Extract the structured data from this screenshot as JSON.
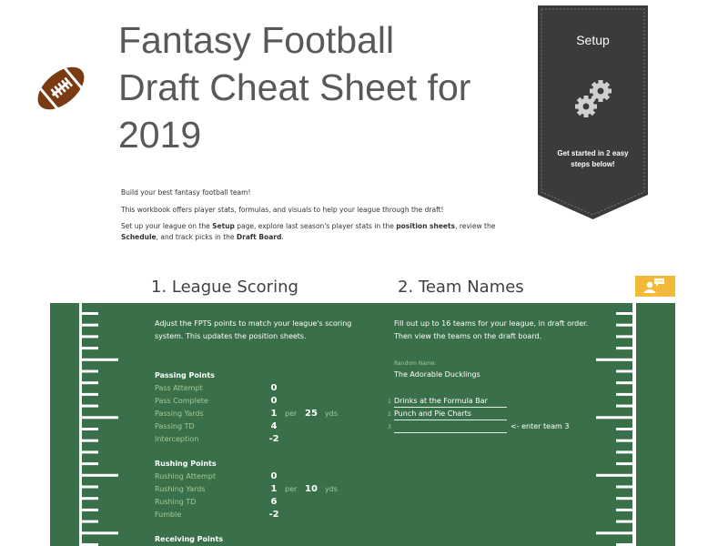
{
  "header": {
    "title_lines": [
      "Fantasy Football",
      "Draft Cheat Sheet for",
      "2019"
    ],
    "logo_icon": "football-icon",
    "colors": {
      "title": "#595959",
      "football": "#7a3b12"
    }
  },
  "intro": {
    "line1": "Build your best fantasy football team!",
    "line2": "This workbook offers player stats, formulas, and visuals to help your league through the draft!",
    "line3": {
      "p1": "Set up your league on the ",
      "b1": "Setup",
      "p2": " page, explore last season's player stats in the ",
      "b2": "position sheets",
      "p3": ", review the ",
      "b3": "Schedule",
      "p4": ", and track picks in the ",
      "b4": "Draft Board",
      "p5": "."
    }
  },
  "banner": {
    "title": "Setup",
    "icon": "gears-icon",
    "subtitle_line1": "Get started in 2 easy",
    "subtitle_line2": "steps below!",
    "color": "#3b3b3b"
  },
  "help_button": {
    "icon": "user-comment-icon",
    "color": "#f2b93b"
  },
  "field_color": "#3a7049",
  "league_scoring": {
    "heading": "1. League Scoring",
    "description_line1": "Adjust the FPTS points to match your league's scoring",
    "description_line2": "system. This updates the position sheets.",
    "per_label": "per",
    "yds_label": "yds",
    "passing": {
      "title": "Passing Points",
      "rows": [
        {
          "label": "Pass Attempt",
          "value": "0"
        },
        {
          "label": "Pass Complete",
          "value": "0"
        },
        {
          "label": "Passing Yards",
          "value": "1",
          "per": "25"
        },
        {
          "label": "Passing TD",
          "value": "4"
        },
        {
          "label": "Interception",
          "value": "-2"
        }
      ]
    },
    "rushing": {
      "title": "Rushing Points",
      "rows": [
        {
          "label": "Rushing Attempt",
          "value": "0"
        },
        {
          "label": "Rushing Yards",
          "value": "1",
          "per": "10"
        },
        {
          "label": "Rushing TD",
          "value": "6"
        },
        {
          "label": "Fumble",
          "value": "-2"
        }
      ]
    },
    "receiving": {
      "title": "Receiving Points"
    }
  },
  "team_names": {
    "heading": "2. Team Names",
    "description_line1": "Fill out up to 16 teams for your league, in draft order.",
    "description_line2": "Then view the teams on the draft board.",
    "random_label": "Random Name:",
    "random_value": "The Adorable Ducklings",
    "teams": [
      {
        "num": "1",
        "name": "Drinks at the Formula Bar"
      },
      {
        "num": "2",
        "name": "Punch and Pie Charts"
      },
      {
        "num": "3",
        "name": ""
      }
    ],
    "hint": "<- enter team 3"
  }
}
